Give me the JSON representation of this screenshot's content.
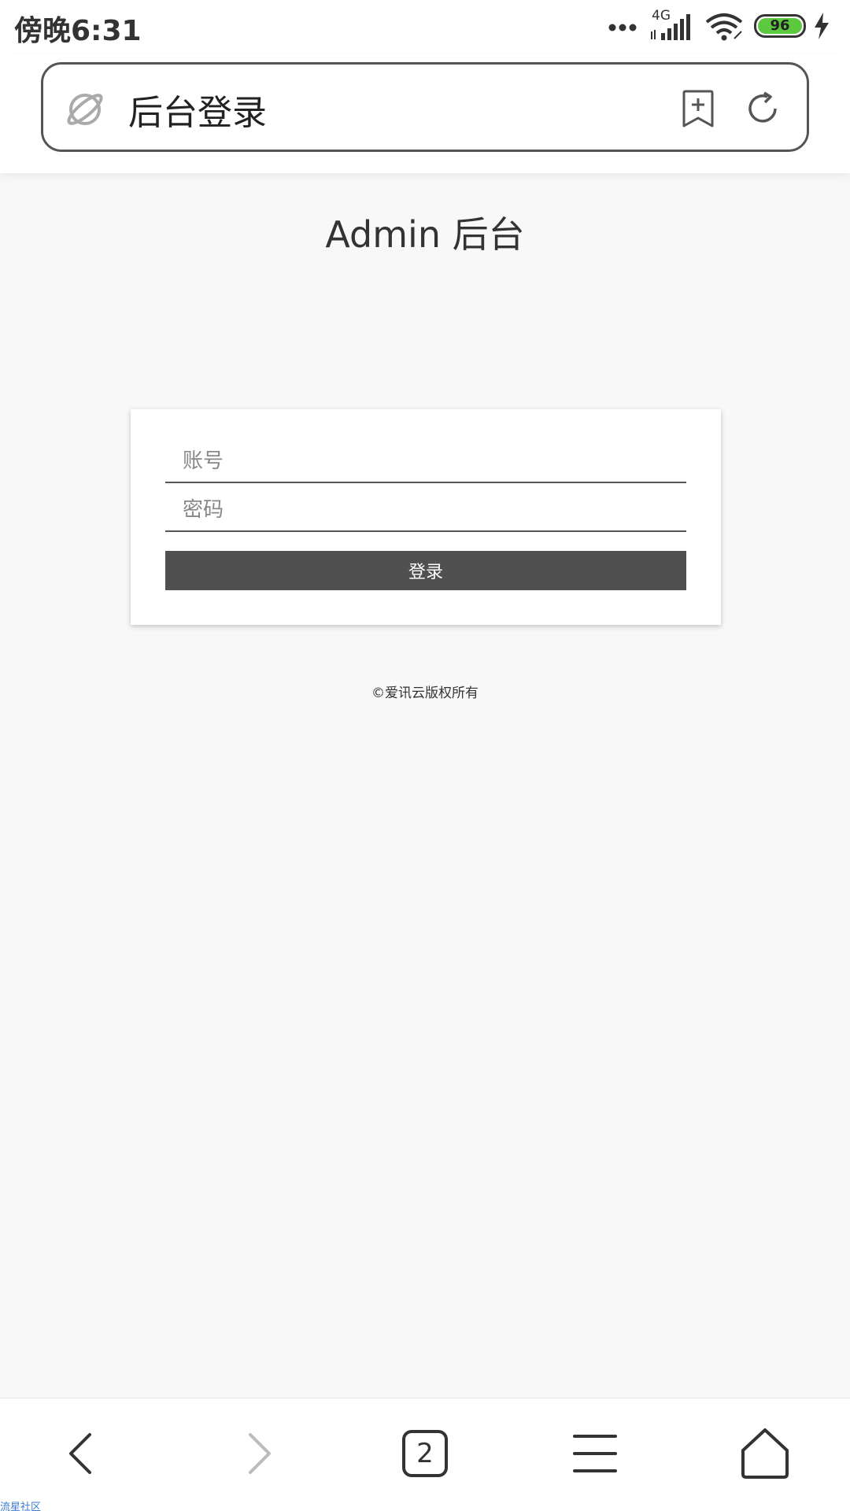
{
  "status_bar": {
    "time": "傍晚6:31",
    "network": "4G",
    "battery": "96"
  },
  "browser": {
    "page_title": "后台登录",
    "tab_count": "2"
  },
  "page": {
    "heading": "Admin 后台",
    "account_placeholder": "账号",
    "password_placeholder": "密码",
    "login_label": "登录",
    "copyright": "©爱讯云版权所有"
  },
  "watermark": "流星社区",
  "colors": {
    "button_bg": "#505050",
    "battery_green": "#5cc93f",
    "background": "#f8f8f8"
  }
}
